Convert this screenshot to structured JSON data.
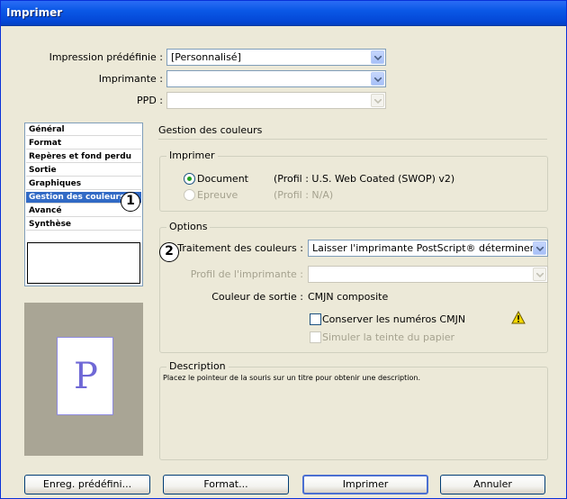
{
  "window": {
    "title": "Imprimer"
  },
  "top_fields": {
    "preset_label": "Impression prédéfinie :",
    "preset_value": "[Personnalisé]",
    "printer_label": "Imprimante :",
    "printer_value": "",
    "ppd_label": "PPD :",
    "ppd_value": ""
  },
  "sidebar": {
    "items": [
      {
        "label": "Général"
      },
      {
        "label": "Format"
      },
      {
        "label": "Repères et fond perdu"
      },
      {
        "label": "Sortie"
      },
      {
        "label": "Graphiques"
      },
      {
        "label": "Gestion des couleurs"
      },
      {
        "label": "Avancé"
      },
      {
        "label": "Synthèse"
      }
    ],
    "selected_index": 5
  },
  "preview": {
    "letter": "P"
  },
  "main": {
    "section_title": "Gestion des couleurs",
    "print_group": {
      "title": "Imprimer",
      "document_label": "Document",
      "document_profile": "(Profil : U.S. Web Coated (SWOP) v2)",
      "proof_label": "Epreuve",
      "proof_profile": "(Profil : N/A)"
    },
    "options_group": {
      "title": "Options",
      "color_handling_label": "Traitement des couleurs :",
      "color_handling_value": "Laisser l'imprimante PostScript® déterminer la",
      "printer_profile_label": "Profil de l'imprimante :",
      "printer_profile_value": "",
      "output_color_label": "Couleur de sortie :",
      "output_color_value": "CMJN composite",
      "preserve_cmyk_label": "Conserver les numéros CMJN",
      "simulate_paper_label": "Simuler la teinte du papier"
    },
    "description_group": {
      "title": "Description",
      "text": "Placez le pointeur de la souris sur un titre pour obtenir une description."
    }
  },
  "callouts": {
    "one": "1",
    "two": "2"
  },
  "buttons": {
    "save_preset": "Enreg. prédéfini...",
    "format": "Format...",
    "print": "Imprimer",
    "cancel": "Annuler"
  },
  "colors": {
    "titlebar": "#0a58e6",
    "dialog_bg": "#ece9d8",
    "selection": "#316ac5",
    "warning": "#f5d800"
  }
}
